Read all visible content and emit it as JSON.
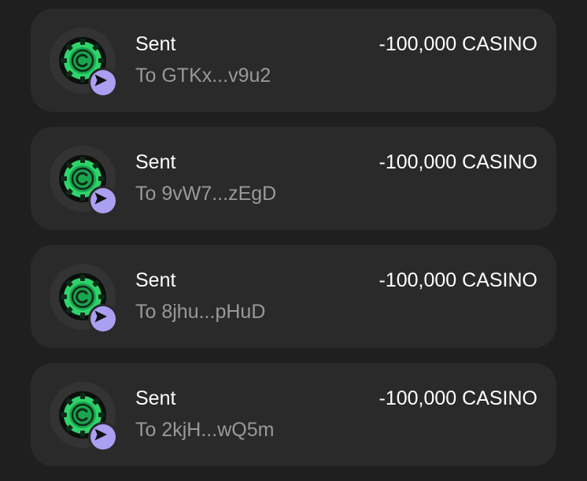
{
  "colors": {
    "background": "#1f1f1f",
    "card": "#2a2a2a",
    "primary_text": "#ffffff",
    "secondary_text": "#999999",
    "badge_accent": "#ab9ff2",
    "token_green": "#2fd36b"
  },
  "icons": {
    "token": "casino-chip-icon",
    "badge": "send-arrow-icon"
  },
  "transactions": [
    {
      "type": "Sent",
      "recipient": "To GTKx...v9u2",
      "amount": "-100,000 CASINO"
    },
    {
      "type": "Sent",
      "recipient": "To 9vW7...zEgD",
      "amount": "-100,000 CASINO"
    },
    {
      "type": "Sent",
      "recipient": "To 8jhu...pHuD",
      "amount": "-100,000 CASINO"
    },
    {
      "type": "Sent",
      "recipient": "To 2kjH...wQ5m",
      "amount": "-100,000 CASINO"
    }
  ]
}
